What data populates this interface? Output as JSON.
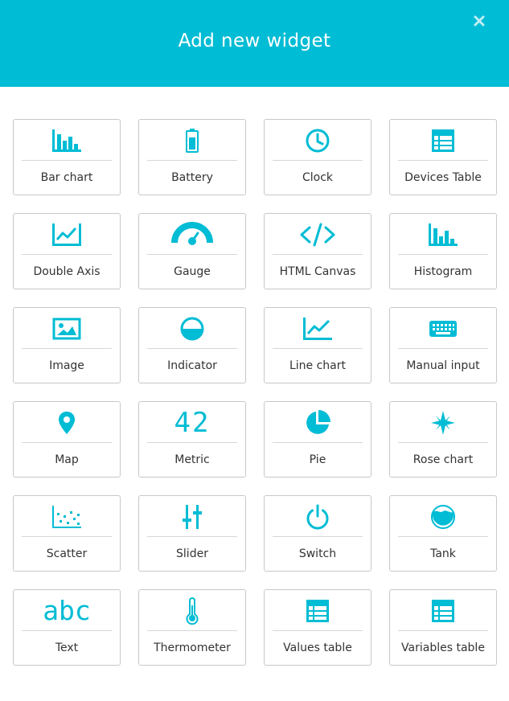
{
  "dialog": {
    "title": "Add new widget",
    "accent_color": "#00bcd4"
  },
  "widgets": [
    {
      "label": "Bar chart",
      "icon": "bar-chart-icon"
    },
    {
      "label": "Battery",
      "icon": "battery-icon"
    },
    {
      "label": "Clock",
      "icon": "clock-icon"
    },
    {
      "label": "Devices Table",
      "icon": "table-icon"
    },
    {
      "label": "Double Axis",
      "icon": "double-axis-icon"
    },
    {
      "label": "Gauge",
      "icon": "gauge-icon"
    },
    {
      "label": "HTML Canvas",
      "icon": "code-icon"
    },
    {
      "label": "Histogram",
      "icon": "histogram-icon"
    },
    {
      "label": "Image",
      "icon": "image-icon"
    },
    {
      "label": "Indicator",
      "icon": "indicator-icon"
    },
    {
      "label": "Line chart",
      "icon": "line-chart-icon"
    },
    {
      "label": "Manual input",
      "icon": "keyboard-icon"
    },
    {
      "label": "Map",
      "icon": "map-pin-icon"
    },
    {
      "label": "Metric",
      "icon": "metric-icon",
      "icon_text": "42"
    },
    {
      "label": "Pie",
      "icon": "pie-chart-icon"
    },
    {
      "label": "Rose chart",
      "icon": "rose-chart-icon"
    },
    {
      "label": "Scatter",
      "icon": "scatter-icon"
    },
    {
      "label": "Slider",
      "icon": "slider-icon"
    },
    {
      "label": "Switch",
      "icon": "power-icon"
    },
    {
      "label": "Tank",
      "icon": "tank-icon"
    },
    {
      "label": "Text",
      "icon": "text-icon",
      "icon_text": "abc"
    },
    {
      "label": "Thermometer",
      "icon": "thermometer-icon"
    },
    {
      "label": "Values table",
      "icon": "table-icon"
    },
    {
      "label": "Variables table",
      "icon": "table-icon"
    }
  ]
}
